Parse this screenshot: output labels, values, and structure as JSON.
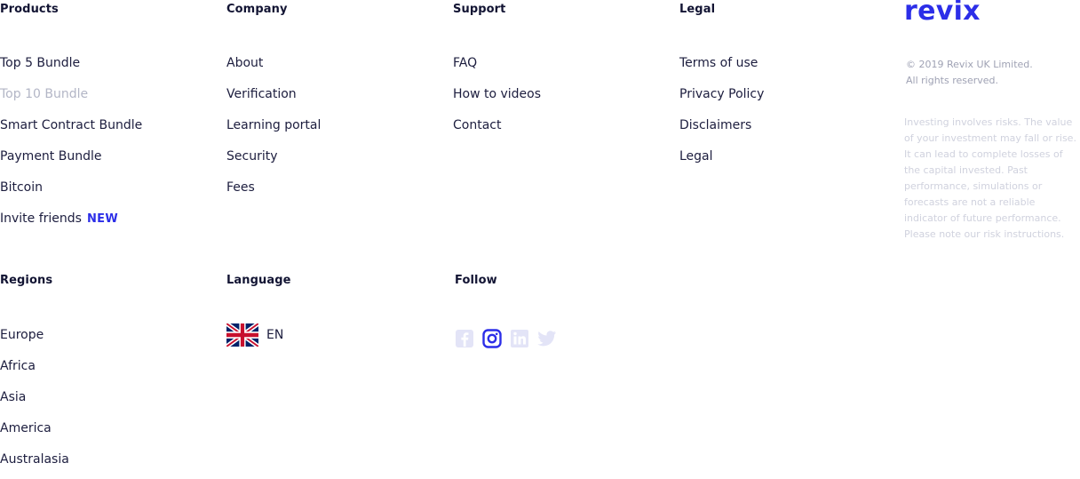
{
  "products": {
    "heading": "Products",
    "items": [
      "Top 5 Bundle",
      "Top 10 Bundle",
      "Smart Contract Bundle",
      "Payment Bundle",
      "Bitcoin",
      "Invite friends"
    ],
    "new_badge": "NEW"
  },
  "company": {
    "heading": "Company",
    "items": [
      "About",
      "Verification",
      "Learning portal",
      "Security",
      "Fees"
    ]
  },
  "support": {
    "heading": "Support",
    "items": [
      "FAQ",
      "How to videos",
      "Contact"
    ]
  },
  "legal": {
    "heading": "Legal",
    "items": [
      "Terms of use",
      "Privacy Policy",
      "Disclaimers",
      "Legal"
    ]
  },
  "brand": {
    "logo": "revix",
    "copyright_line1": "© 2019 Revix UK Limited.",
    "copyright_line2": "All rights reserved.",
    "disclaimer": "Investing involves risks. The value of your investment may fall or rise. It can lead to complete losses of the capital invested. Past performance, simulations or forecasts are not a reliable indicator of future performance. Please note our risk instructions."
  },
  "regions": {
    "heading": "Regions",
    "items": [
      "Europe",
      "Africa",
      "Asia",
      "America",
      "Australasia"
    ]
  },
  "language": {
    "heading": "Language",
    "current": "EN",
    "flag_icon": "uk-flag-icon"
  },
  "follow": {
    "heading": "Follow",
    "icons": [
      "facebook-icon",
      "instagram-icon",
      "linkedin-icon",
      "twitter-icon"
    ]
  },
  "colors": {
    "accent": "#2c2ee8",
    "text": "#1c1d3e",
    "muted_link": "#b3b6c6",
    "social_faded": "#e3e4f7"
  }
}
